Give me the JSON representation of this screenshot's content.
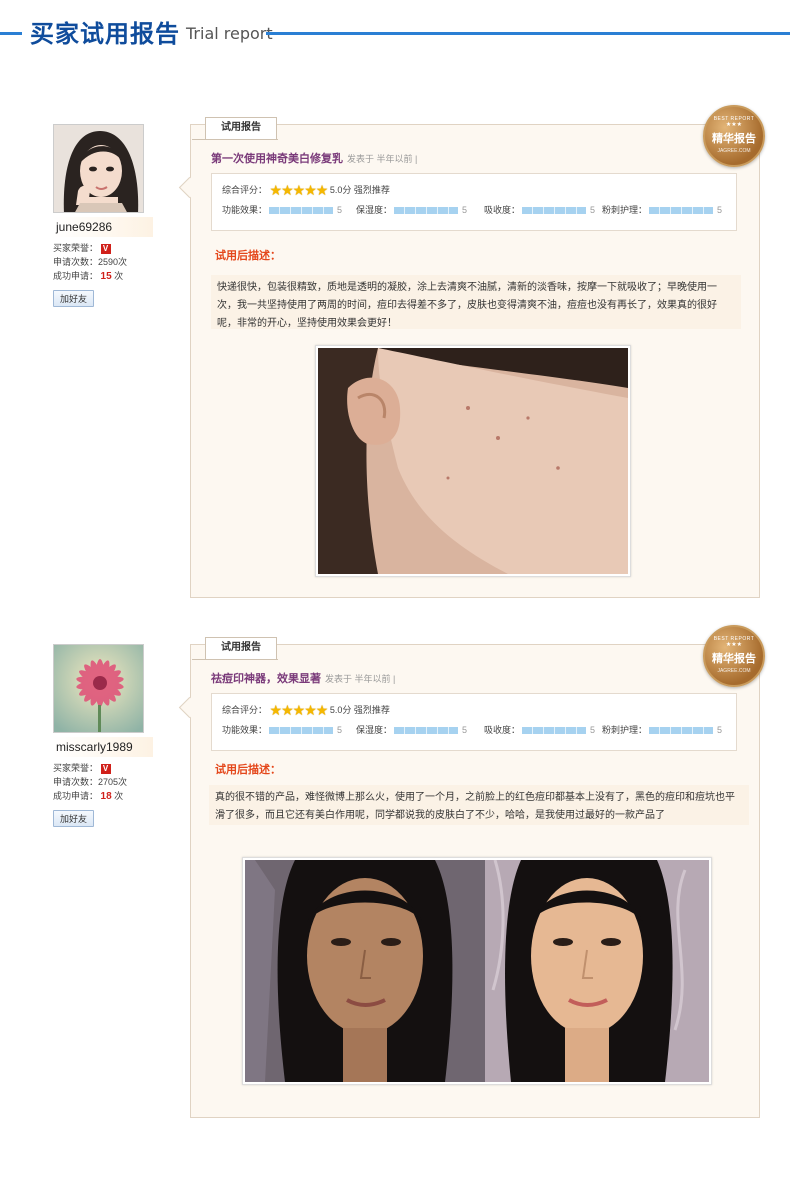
{
  "header": {
    "title": "买家试用报告",
    "subtitle": "Trial report"
  },
  "reports": [
    {
      "user": {
        "name": "june69286",
        "honor_label": "买家荣誉：",
        "honor_badge": "V",
        "apply_label": "申请次数：",
        "apply_value": "2590次",
        "success_label": "成功申请：",
        "success_value": "15",
        "success_unit": "次",
        "add_friend": "加好友"
      },
      "tab": "试用报告",
      "title": "第一次使用神奇美白修复乳",
      "meta": "发表于 半年以前 |",
      "seal": {
        "top": "BEST REPORT",
        "main": "精华报告",
        "bottom": "JAGREE.COM"
      },
      "overall_label": "综合评分：",
      "overall_stars": 5,
      "overall_text": "5.0分 强烈推荐",
      "metrics": [
        {
          "label": "功能效果：",
          "value": "5"
        },
        {
          "label": "保湿度：",
          "value": "5"
        },
        {
          "label": "吸收度：",
          "value": "5"
        },
        {
          "label": "粉刺护理：",
          "value": "5"
        }
      ],
      "desc_heading": "试用后描述：",
      "desc": "快递很快，包装很精致，质地是透明的凝胶，涂上去清爽不油腻，清新的淡香味，按摩一下就吸收了；早晚使用一次，我一共坚持使用了两周的时间，痘印去得差不多了，皮肤也变得清爽不油，痘痘也没有再长了，效果真的很好呢，非常的开心，坚持使用效果会更好！"
    },
    {
      "user": {
        "name": "misscarly1989",
        "honor_label": "买家荣誉：",
        "honor_badge": "V",
        "apply_label": "申请次数：",
        "apply_value": "2705次",
        "success_label": "成功申请：",
        "success_value": "18",
        "success_unit": "次",
        "add_friend": "加好友"
      },
      "tab": "试用报告",
      "title": "祛痘印神器，效果显著",
      "meta": "发表于 半年以前 |",
      "seal": {
        "top": "BEST REPORT",
        "main": "精华报告",
        "bottom": "JAGREE.COM"
      },
      "overall_label": "综合评分：",
      "overall_stars": 5,
      "overall_text": "5.0分 强烈推荐",
      "metrics": [
        {
          "label": "功能效果：",
          "value": "5"
        },
        {
          "label": "保湿度：",
          "value": "5"
        },
        {
          "label": "吸收度：",
          "value": "5"
        },
        {
          "label": "粉刺护理：",
          "value": "5"
        }
      ],
      "desc_heading": "试用后描述：",
      "desc": "真的很不错的产品，难怪微博上那么火，使用了一个月，之前脸上的红色痘印都基本上没有了，黑色的痘印和痘坑也平滑了很多，而且它还有美白作用呢，同学都说我的皮肤白了不少，哈哈，是我使用过最好的一款产品了"
    }
  ],
  "colors": {
    "accent_blue": "#2a7fd4",
    "title_blue": "#0f4c9c",
    "report_title": "#7a3a7a",
    "desc_heading": "#e4471b",
    "star": "#f5b800"
  }
}
